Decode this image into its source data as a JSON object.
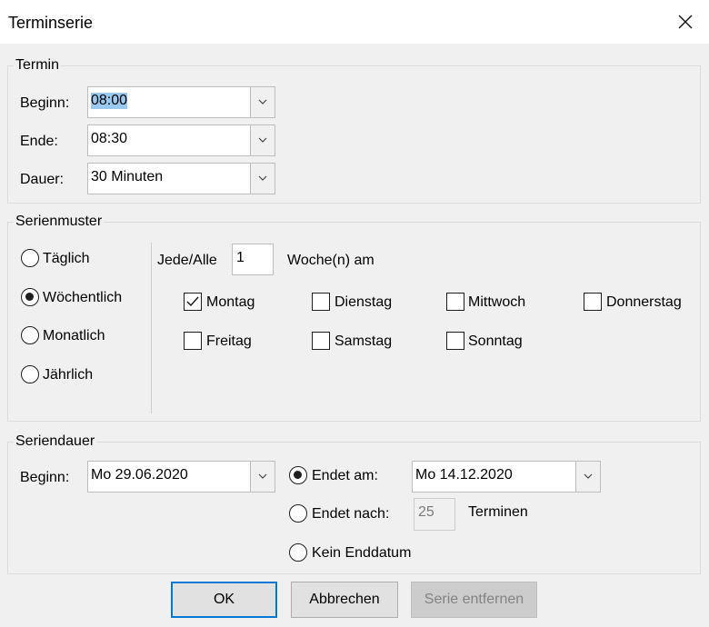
{
  "window": {
    "title": "Terminserie"
  },
  "termin": {
    "legend": "Termin",
    "start_label": "Beginn:",
    "start_value": "08:00",
    "end_label": "Ende:",
    "end_value": "08:30",
    "duration_label": "Dauer:",
    "duration_value": "30 Minuten"
  },
  "pattern": {
    "legend": "Serienmuster",
    "options": [
      "Täglich",
      "Wöchentlich",
      "Monatlich",
      "Jährlich"
    ],
    "selected": "Wöchentlich",
    "every_label": "Jede/Alle",
    "every_value": "1",
    "weeks_suffix": "Woche(n) am",
    "days": [
      {
        "label": "Montag",
        "checked": true
      },
      {
        "label": "Dienstag",
        "checked": false
      },
      {
        "label": "Mittwoch",
        "checked": false
      },
      {
        "label": "Donnerstag",
        "checked": false
      },
      {
        "label": "Freitag",
        "checked": false
      },
      {
        "label": "Samstag",
        "checked": false
      },
      {
        "label": "Sonntag",
        "checked": false
      }
    ]
  },
  "range": {
    "legend": "Seriendauer",
    "start_label": "Beginn:",
    "start_value": "Mo 29.06.2020",
    "end_by_label": "Endet am:",
    "end_by_value": "Mo 14.12.2020",
    "end_after_label": "Endet nach:",
    "end_after_value": "25",
    "occurrences_label": "Terminen",
    "no_end_label": "Kein Enddatum",
    "selected": "Endet am:"
  },
  "buttons": {
    "ok": "OK",
    "cancel": "Abbrechen",
    "remove": "Serie entfernen"
  },
  "icons": {
    "close": "close-icon",
    "dropdown": "chevron-down-icon",
    "check": "checkmark-icon"
  }
}
